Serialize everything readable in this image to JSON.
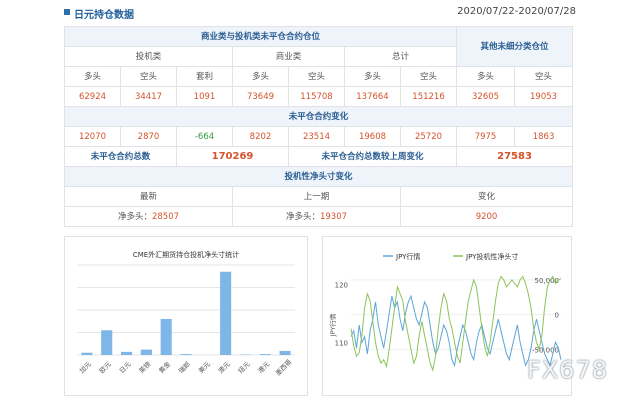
{
  "header": {
    "title": "日元持仓数据",
    "date_range": "2020/07/22-2020/07/28"
  },
  "table": {
    "section1_title": "商业类与投机类未平仓合约仓位",
    "other_title": "其他未细分类仓位",
    "groups": [
      "投机类",
      "商业类",
      "总计"
    ],
    "cols": [
      "多头",
      "空头",
      "套利",
      "多头",
      "空头",
      "多头",
      "空头",
      "多头",
      "空头"
    ],
    "positions": [
      "62924",
      "34417",
      "1091",
      "73649",
      "115708",
      "137664",
      "151216",
      "32605",
      "19053"
    ],
    "change_title": "未平仓合约变化",
    "changes": [
      "12070",
      "2870",
      "-664",
      "8202",
      "23514",
      "19608",
      "25720",
      "7975",
      "1863"
    ],
    "oi_total_label": "未平仓合约总数",
    "oi_total_value": "170269",
    "oi_change_label": "未平仓合约总数较上周变化",
    "oi_change_value": "27583",
    "net_title": "投机性净头寸变化",
    "net_headers": [
      "最新",
      "上一期",
      "变化"
    ],
    "net_label": "净多头：",
    "net_latest": "28507",
    "net_previous": "19307",
    "net_change": "9200"
  },
  "chart_data": [
    {
      "type": "bar",
      "title": "CME外汇期货持仓投机净头寸统计",
      "categories": [
        "加元",
        "欧元",
        "日元",
        "英镑",
        "黄金",
        "瑞郎",
        "美元",
        "澳元",
        "纽元",
        "港元",
        "墨西哥"
      ],
      "values": [
        500,
        5500,
        700,
        1200,
        8000,
        200,
        0,
        18500,
        100,
        200,
        900
      ],
      "ylim": [
        0,
        20000
      ],
      "colors": {
        "bar": "#7eb6e8",
        "grid": "#e6e6e6"
      }
    },
    {
      "type": "line",
      "legend": [
        "JPY行情",
        "JPY投机性净头寸"
      ],
      "ylabel_left": "JPY行情",
      "left_ticks": [
        "120",
        "110"
      ],
      "right_ticks": [
        "50,000",
        "0",
        "-50,000"
      ],
      "series": [
        {
          "name": "JPY行情",
          "color": "#5aa6d8",
          "values": [
            111,
            112,
            109,
            113,
            110,
            111,
            108,
            112,
            114,
            117,
            113,
            111,
            109,
            112,
            115,
            118,
            116,
            117,
            114,
            112,
            115,
            117,
            118,
            116,
            114,
            113,
            115,
            117,
            116,
            113,
            110,
            108,
            109,
            111,
            113,
            112,
            110,
            107,
            106,
            109,
            111,
            113,
            112,
            110,
            108,
            107,
            110,
            112,
            113,
            111,
            109,
            108,
            110,
            112,
            114,
            112,
            110,
            108,
            107,
            109,
            111,
            113,
            110,
            108,
            106,
            107,
            109,
            112,
            114,
            112,
            110,
            108,
            107,
            106,
            108,
            110,
            109,
            107
          ]
        },
        {
          "name": "JPY投机性净头寸",
          "color": "#8cc35c",
          "values": [
            -20000,
            -45000,
            -60000,
            -55000,
            -30000,
            10000,
            30000,
            20000,
            -10000,
            -40000,
            -60000,
            -70000,
            -65000,
            -75000,
            -50000,
            -20000,
            10000,
            40000,
            30000,
            20000,
            -10000,
            -30000,
            -50000,
            -70000,
            -60000,
            -30000,
            -10000,
            -30000,
            -50000,
            -70000,
            -80000,
            -60000,
            -20000,
            10000,
            30000,
            20000,
            -5000,
            -20000,
            -40000,
            -60000,
            -70000,
            -40000,
            -10000,
            20000,
            35000,
            50000,
            40000,
            10000,
            -20000,
            -45000,
            -60000,
            -40000,
            -10000,
            20000,
            45000,
            55000,
            50000,
            40000,
            45000,
            50000,
            45000,
            40000,
            50000,
            55000,
            45000,
            30000,
            10000,
            -20000,
            -40000,
            -50000,
            -30000,
            10000,
            40000,
            50000,
            55000,
            45000,
            50000,
            52000
          ]
        }
      ]
    }
  ],
  "watermark": "FX678"
}
